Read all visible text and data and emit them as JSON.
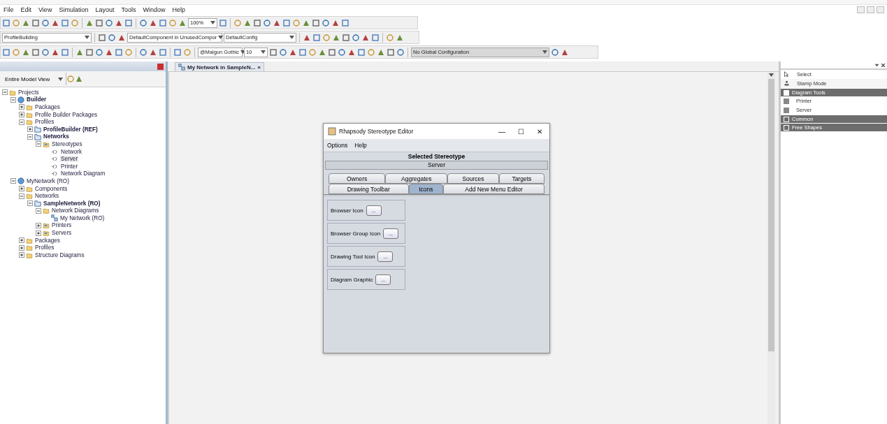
{
  "menu": [
    "File",
    "Edit",
    "View",
    "Simulation",
    "Layout",
    "Tools",
    "Window",
    "Help"
  ],
  "toolbar": {
    "zoom": "100%",
    "profile": "ProfileBuilding",
    "component": "DefaultComponent in UnusedCompor",
    "config": "DefaultConfig",
    "font": "@Malgun Gothic",
    "font_size": "10",
    "global_config": "No Global Configuration"
  },
  "browser": {
    "view": "Entire Model View",
    "tree": [
      {
        "label": "Projects",
        "kind": "folder",
        "bold": false,
        "selected": false,
        "expanded": true,
        "children": [
          {
            "label": "Builder",
            "kind": "project",
            "bold": true,
            "selected": false,
            "expanded": true,
            "children": [
              {
                "label": "Packages",
                "kind": "folder",
                "bold": false,
                "selected": false,
                "expanded": false
              },
              {
                "label": "Profile Builder Packages",
                "kind": "folder",
                "bold": false,
                "selected": false,
                "expanded": false
              },
              {
                "label": "Profiles",
                "kind": "folder",
                "bold": false,
                "selected": false,
                "expanded": true,
                "children": [
                  {
                    "label": "ProfileBuilder (REF)",
                    "kind": "package",
                    "bold": true,
                    "selected": false,
                    "expanded": false
                  },
                  {
                    "label": "Networks",
                    "kind": "package",
                    "bold": true,
                    "selected": false,
                    "expanded": true,
                    "children": [
                      {
                        "label": "Stereotypes",
                        "kind": "open-folder",
                        "bold": false,
                        "selected": false,
                        "expanded": true,
                        "children": [
                          {
                            "label": "Network",
                            "kind": "stereotype",
                            "bold": false,
                            "selected": false
                          },
                          {
                            "label": "Server",
                            "kind": "stereotype",
                            "bold": false,
                            "selected": true
                          },
                          {
                            "label": "Printer",
                            "kind": "stereotype",
                            "bold": false,
                            "selected": false
                          },
                          {
                            "label": "Network Diagram",
                            "kind": "stereotype",
                            "bold": false,
                            "selected": false
                          }
                        ]
                      }
                    ]
                  }
                ]
              }
            ]
          },
          {
            "label": "MyNetwork (RO)",
            "kind": "project",
            "bold": false,
            "selected": false,
            "expanded": true,
            "children": [
              {
                "label": "Components",
                "kind": "folder",
                "bold": false,
                "selected": false,
                "expanded": false
              },
              {
                "label": "Networks",
                "kind": "folder",
                "bold": false,
                "selected": false,
                "expanded": true,
                "children": [
                  {
                    "label": "SampleNetwork (RO)",
                    "kind": "package",
                    "bold": true,
                    "selected": false,
                    "expanded": true,
                    "children": [
                      {
                        "label": "Network Diagrams",
                        "kind": "folder",
                        "bold": false,
                        "selected": false,
                        "expanded": true,
                        "children": [
                          {
                            "label": "My Network (RO)",
                            "kind": "diagram",
                            "bold": false,
                            "selected": false
                          }
                        ]
                      },
                      {
                        "label": "Printers",
                        "kind": "open-folder",
                        "bold": false,
                        "selected": false,
                        "expanded": false
                      },
                      {
                        "label": "Servers",
                        "kind": "open-folder",
                        "bold": false,
                        "selected": false,
                        "expanded": false
                      }
                    ]
                  }
                ]
              },
              {
                "label": "Packages",
                "kind": "folder",
                "bold": false,
                "selected": false,
                "expanded": false
              },
              {
                "label": "Profiles",
                "kind": "folder",
                "bold": false,
                "selected": false,
                "expanded": false
              },
              {
                "label": "Structure Diagrams",
                "kind": "folder",
                "bold": false,
                "selected": false,
                "expanded": false
              }
            ]
          }
        ]
      }
    ]
  },
  "editor_tab": {
    "label": "My Network in SampleN...",
    "close": "×"
  },
  "dialog": {
    "title": "Rhapsody Stereotype Editor",
    "controls": [
      "—",
      "☐",
      "✕"
    ],
    "menu": [
      "Options",
      "Help"
    ],
    "heading": "Selected Stereotype",
    "stereotype": "Server",
    "tab_rows": [
      [
        {
          "label": "Owners",
          "selected": false
        },
        {
          "label": "Aggregates",
          "selected": false
        },
        {
          "label": "Sources",
          "selected": false
        },
        {
          "label": "Targets",
          "selected": false
        }
      ],
      [
        {
          "label": "Drawing Toolbar",
          "selected": false
        },
        {
          "label": "Icons",
          "selected": true
        },
        {
          "label": "Add New Menu Editor",
          "selected": false
        }
      ]
    ],
    "icon_rows": [
      {
        "label": "Browser Icon",
        "button": "..."
      },
      {
        "label": "Browser Group Icon",
        "button": "..."
      },
      {
        "label": "Drawing Tool Icon",
        "button": "..."
      },
      {
        "label": "Diagram Graphic",
        "button": "..."
      }
    ]
  },
  "palette": {
    "tools": [
      {
        "label": "Select",
        "kind": "pointer"
      },
      {
        "label": "Stamp Mode",
        "kind": "stamp"
      }
    ],
    "sections": [
      {
        "title": "Diagram Tools",
        "expanded": true,
        "items": [
          "Printer",
          "Server"
        ]
      },
      {
        "title": "Common",
        "expanded": false
      },
      {
        "title": "Free Shapes",
        "expanded": false
      }
    ]
  }
}
